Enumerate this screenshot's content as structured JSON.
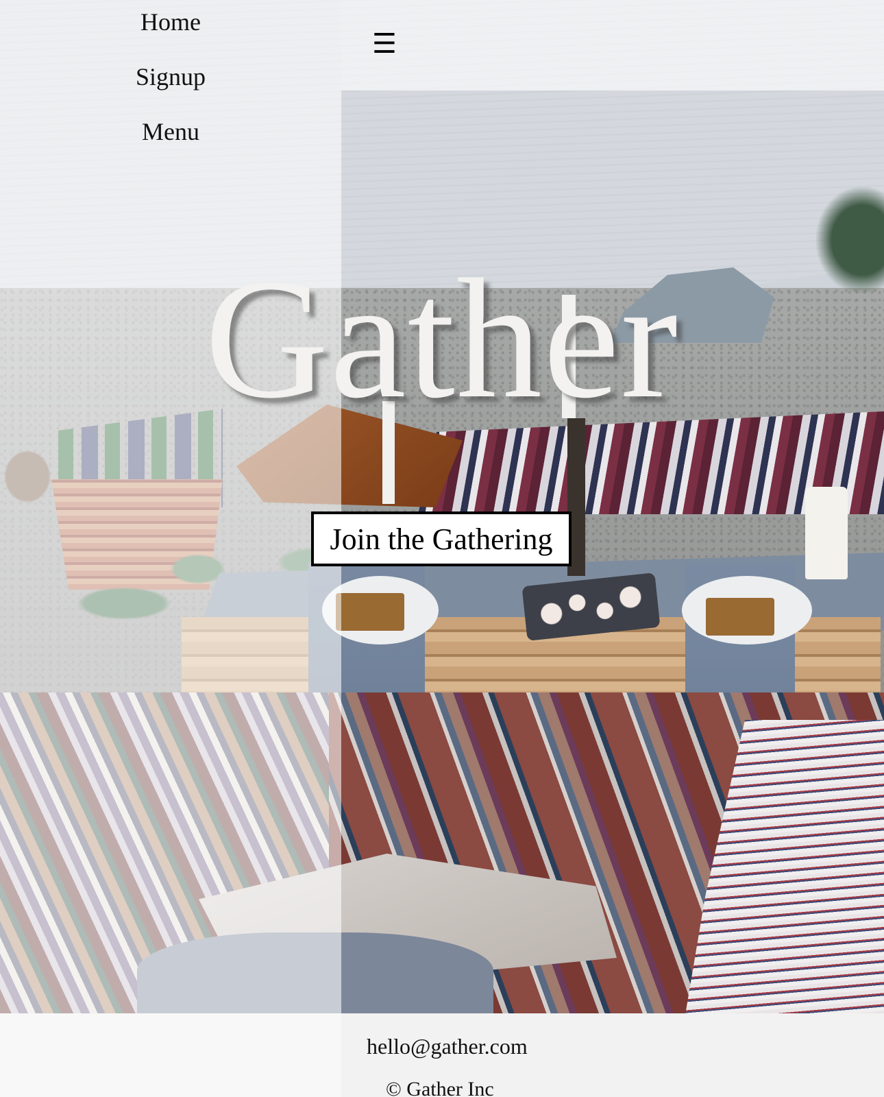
{
  "nav": {
    "items": [
      {
        "label": "Home"
      },
      {
        "label": "Signup"
      },
      {
        "label": "Menu"
      }
    ],
    "menu_toggle": "☰"
  },
  "hero": {
    "title": "Gather",
    "cta_label": "Join the Gathering"
  },
  "footer": {
    "email": "hello@gather.com",
    "copyright": "© Gather Inc"
  }
}
